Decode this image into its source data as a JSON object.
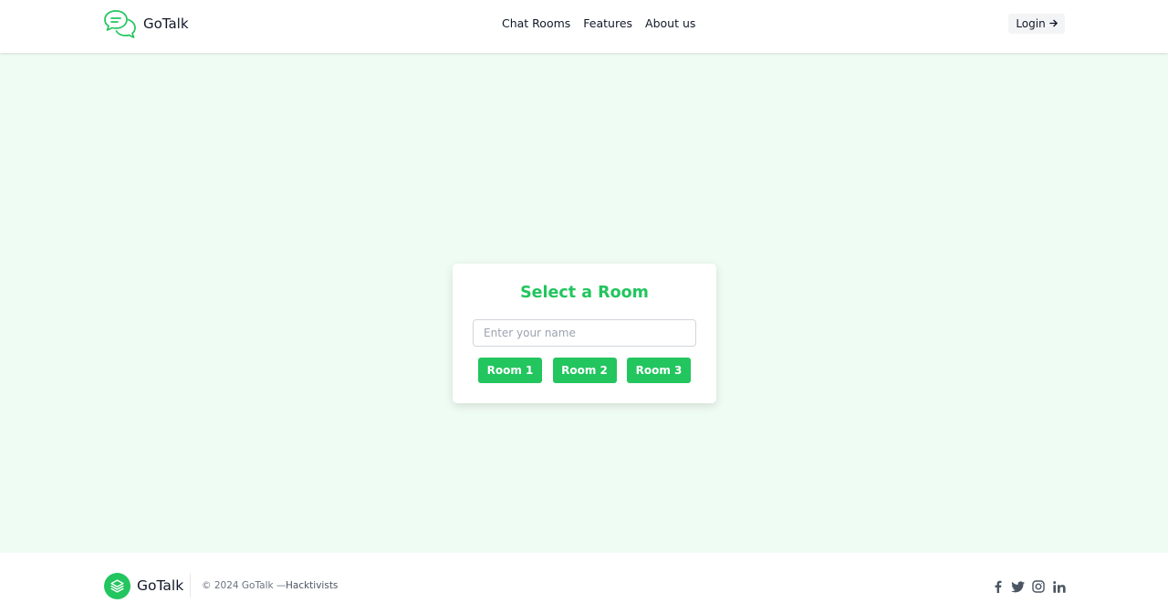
{
  "header": {
    "brand_name": "GoTalk",
    "nav": [
      {
        "label": "Chat Rooms"
      },
      {
        "label": "Features"
      },
      {
        "label": "About us"
      }
    ],
    "login_label": "Login"
  },
  "card": {
    "title": "Select a Room",
    "name_placeholder": "Enter your name",
    "name_value": "",
    "rooms": [
      {
        "label": "Room 1"
      },
      {
        "label": "Room 2"
      },
      {
        "label": "Room 3"
      }
    ]
  },
  "footer": {
    "brand_name": "GoTalk",
    "copyright": "© 2024 GoTalk —",
    "org": "Hacktivists",
    "socials": [
      "facebook-icon",
      "twitter-icon",
      "instagram-icon",
      "linkedin-icon"
    ]
  },
  "colors": {
    "accent": "#22c55e",
    "page_bg": "#effcf3",
    "text": "#111827"
  }
}
